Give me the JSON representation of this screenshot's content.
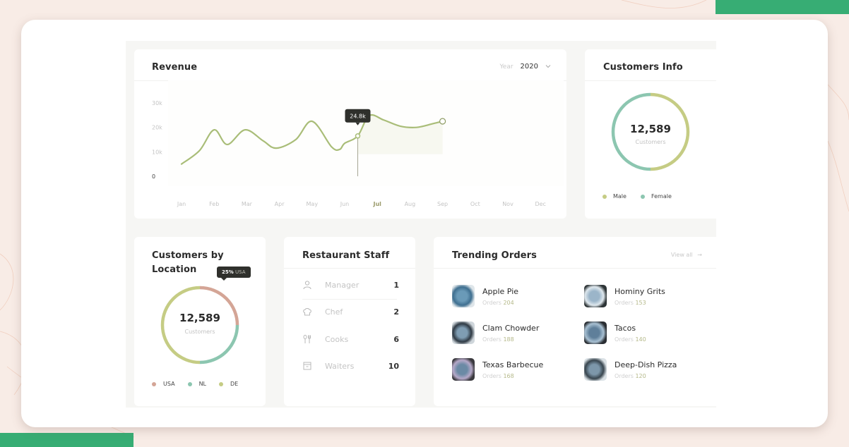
{
  "colors": {
    "accent_green": "#37ad74",
    "line_olive": "#a9bd78",
    "female_teal": "#8cc6b0",
    "male_olive": "#c5cc84",
    "usa_rose": "#d4a596",
    "nl_teal": "#8cc6b0",
    "de_olive": "#c5cc84",
    "tooltip_dark": "#2f302c"
  },
  "revenue": {
    "title": "Revenue",
    "year_label": "Year",
    "year_value": "2020",
    "tooltip": "24.8k"
  },
  "chart_data": {
    "type": "line",
    "title": "Revenue",
    "xlabel": "",
    "ylabel": "",
    "categories": [
      "Jan",
      "Feb",
      "Mar",
      "Apr",
      "May",
      "Jun",
      "Jul",
      "Aug",
      "Sep",
      "Oct",
      "Nov",
      "Dec"
    ],
    "y_ticks": [
      "0",
      "10k",
      "20k",
      "30k"
    ],
    "ylim": [
      0,
      30000
    ],
    "active_category": "Jul",
    "series": [
      {
        "name": "Revenue",
        "points": [
          [
            0.0,
            5000
          ],
          [
            0.55,
            10500
          ],
          [
            1.0,
            19000
          ],
          [
            1.4,
            13000
          ],
          [
            1.95,
            19000
          ],
          [
            2.5,
            14500
          ],
          [
            2.9,
            11500
          ],
          [
            3.5,
            15000
          ],
          [
            4.0,
            22500
          ],
          [
            4.6,
            12000
          ],
          [
            4.85,
            11000
          ],
          [
            5.0,
            13500
          ],
          [
            5.4,
            16500
          ],
          [
            5.75,
            24800
          ],
          [
            6.2,
            23000
          ],
          [
            6.7,
            20500
          ],
          [
            7.2,
            20000
          ],
          [
            7.7,
            21500
          ],
          [
            8.0,
            22500
          ]
        ],
        "marker_index": 12,
        "end_marker_index": 18
      }
    ],
    "tooltip_value": "24.8k",
    "grid": false,
    "legend": "none"
  },
  "customers_info": {
    "title": "Customers Info",
    "total": "12,589",
    "total_label": "Customers",
    "segments": [
      {
        "name": "Male",
        "fraction": 0.5,
        "color": "#c5cc84"
      },
      {
        "name": "Female",
        "fraction": 0.5,
        "color": "#8cc6b0"
      }
    ]
  },
  "customers_by_location": {
    "title": "Customers  by Location",
    "total": "12,589",
    "total_label": "Customers",
    "tooltip_pct": "25%",
    "tooltip_country": "USA",
    "segments": [
      {
        "name": "USA",
        "fraction": 0.25,
        "color": "#d4a596"
      },
      {
        "name": "NL",
        "fraction": 0.25,
        "color": "#8cc6b0"
      },
      {
        "name": "DE",
        "fraction": 0.5,
        "color": "#c5cc84"
      }
    ]
  },
  "staff": {
    "title": "Restaurant Staff",
    "rows": [
      {
        "icon": "person-icon",
        "name": "Manager",
        "count": "1"
      },
      {
        "icon": "chef-hat-icon",
        "name": "Chef",
        "count": "2"
      },
      {
        "icon": "fork-spoon-icon",
        "name": "Cooks",
        "count": "6"
      },
      {
        "icon": "tray-icon",
        "name": "Waiters",
        "count": "10"
      }
    ]
  },
  "trending": {
    "title": "Trending Orders",
    "view_all": "View all",
    "view_all_arrow": "→",
    "orders_label": "Orders",
    "items": [
      {
        "name": "Apple Pie",
        "orders": "204"
      },
      {
        "name": "Hominy Grits",
        "orders": "153"
      },
      {
        "name": "Clam Chowder",
        "orders": "188"
      },
      {
        "name": "Tacos",
        "orders": "140"
      },
      {
        "name": "Texas Barbecue",
        "orders": "168"
      },
      {
        "name": "Deep-Dish Pizza",
        "orders": "120"
      }
    ]
  }
}
